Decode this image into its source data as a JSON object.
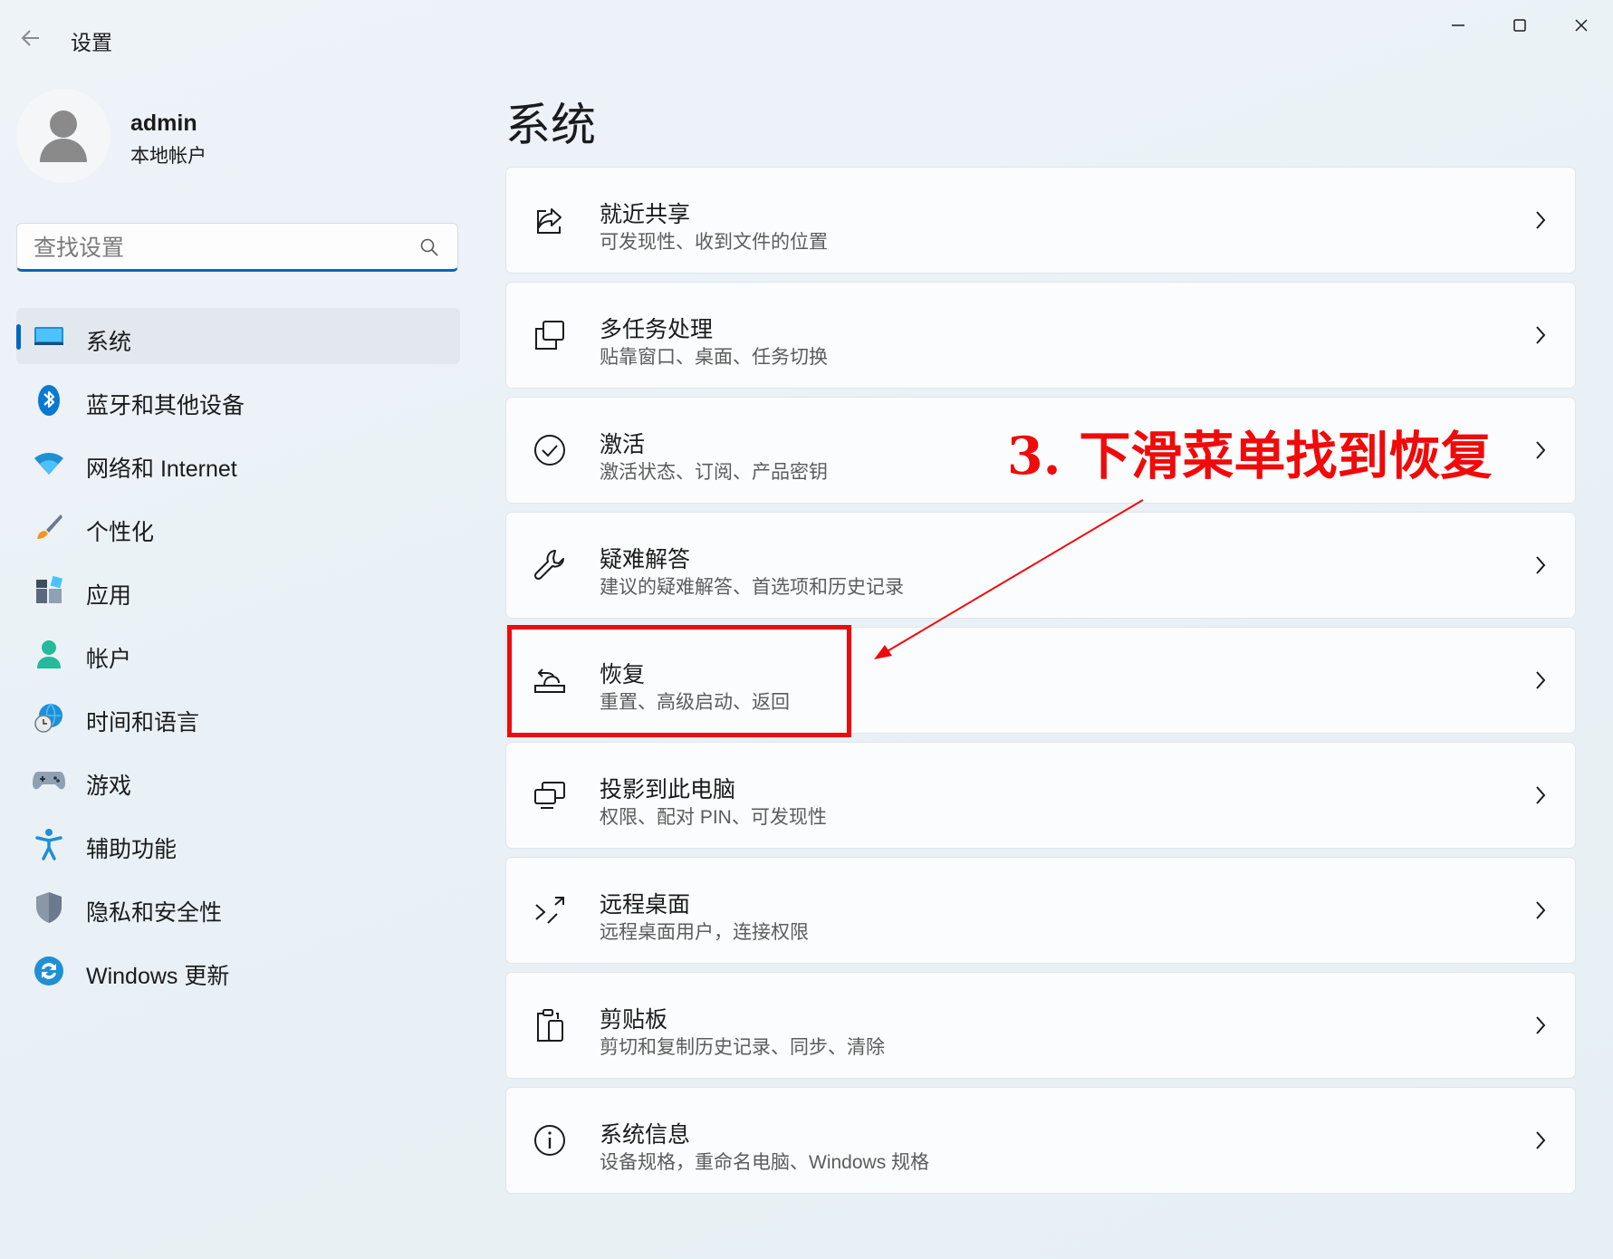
{
  "window": {
    "title": "设置",
    "controls": {
      "minimize": "minimize-icon",
      "maximize": "maximize-icon",
      "close": "close-icon"
    }
  },
  "profile": {
    "name": "admin",
    "account_type": "本地帐户"
  },
  "search": {
    "placeholder": "查找设置",
    "value": ""
  },
  "sidebar": {
    "items": [
      {
        "label": "系统",
        "icon": "monitor-icon",
        "active": true
      },
      {
        "label": "蓝牙和其他设备",
        "icon": "bluetooth-icon"
      },
      {
        "label": "网络和 Internet",
        "icon": "wifi-icon"
      },
      {
        "label": "个性化",
        "icon": "brush-icon"
      },
      {
        "label": "应用",
        "icon": "apps-icon"
      },
      {
        "label": "帐户",
        "icon": "person-icon"
      },
      {
        "label": "时间和语言",
        "icon": "globe-clock-icon"
      },
      {
        "label": "游戏",
        "icon": "gamepad-icon"
      },
      {
        "label": "辅助功能",
        "icon": "accessibility-icon"
      },
      {
        "label": "隐私和安全性",
        "icon": "shield-icon"
      },
      {
        "label": "Windows 更新",
        "icon": "update-icon"
      }
    ]
  },
  "main": {
    "title": "系统",
    "cards": [
      {
        "title": "就近共享",
        "desc": "可发现性、收到文件的位置",
        "icon": "share-icon"
      },
      {
        "title": "多任务处理",
        "desc": "贴靠窗口、桌面、任务切换",
        "icon": "multitask-icon"
      },
      {
        "title": "激活",
        "desc": "激活状态、订阅、产品密钥",
        "icon": "check-circle-icon"
      },
      {
        "title": "疑难解答",
        "desc": "建议的疑难解答、首选项和历史记录",
        "icon": "wrench-icon"
      },
      {
        "title": "恢复",
        "desc": "重置、高级启动、返回",
        "icon": "recovery-icon"
      },
      {
        "title": "投影到此电脑",
        "desc": "权限、配对 PIN、可发现性",
        "icon": "project-icon"
      },
      {
        "title": "远程桌面",
        "desc": "远程桌面用户，连接权限",
        "icon": "remote-desktop-icon"
      },
      {
        "title": "剪贴板",
        "desc": "剪切和复制历史记录、同步、清除",
        "icon": "clipboard-icon"
      },
      {
        "title": "系统信息",
        "desc": "设备规格，重命名电脑、Windows 规格",
        "icon": "info-icon"
      }
    ]
  },
  "annotation": {
    "text": "3. 下滑菜单找到恢复",
    "color": "#f00a0a"
  },
  "colors": {
    "accent": "#0067c0"
  }
}
